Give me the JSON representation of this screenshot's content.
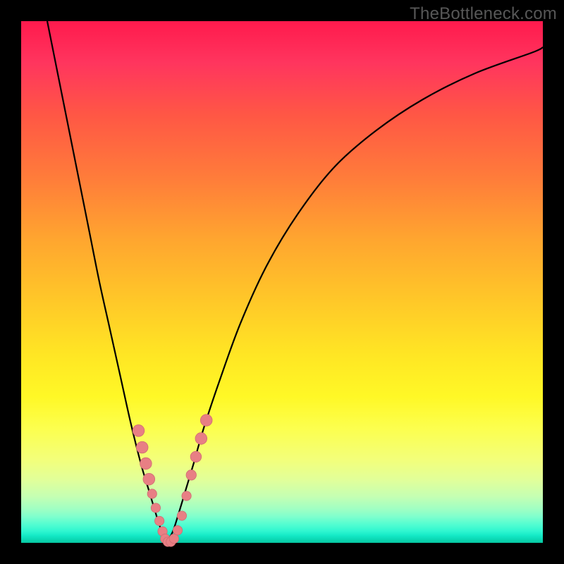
{
  "watermark": "TheBottleneck.com",
  "colors": {
    "curve": "#000000",
    "marker_fill": "#e87f84",
    "marker_stroke": "#cf6d72",
    "background_frame": "#000000"
  },
  "chart_data": {
    "type": "line",
    "title": "",
    "xlabel": "",
    "ylabel": "",
    "xlim": [
      0,
      100
    ],
    "ylim": [
      0,
      100
    ],
    "grid": false,
    "legend": false,
    "series": [
      {
        "name": "bottleneck-curve-left",
        "x": [
          5,
          7,
          9,
          11,
          13,
          15,
          17,
          19,
          21,
          23,
          24.5,
          26,
          27,
          27.8
        ],
        "values": [
          100,
          90,
          80,
          70,
          60,
          50,
          41,
          32,
          23,
          15,
          10,
          5,
          2,
          0
        ]
      },
      {
        "name": "bottleneck-curve-right",
        "x": [
          27.8,
          29,
          30,
          31.5,
          33,
          35,
          38,
          42,
          47,
          53,
          60,
          68,
          77,
          87,
          98,
          100
        ],
        "values": [
          0,
          2,
          5,
          10,
          15,
          22,
          31,
          42,
          53,
          63,
          72,
          79,
          85,
          90,
          94,
          95
        ]
      }
    ],
    "markers": [
      {
        "x": 22.5,
        "y": 21.5,
        "r": 1.5
      },
      {
        "x": 23.2,
        "y": 18.3,
        "r": 1.5
      },
      {
        "x": 23.9,
        "y": 15.2,
        "r": 1.5
      },
      {
        "x": 24.5,
        "y": 12.2,
        "r": 1.5
      },
      {
        "x": 25.1,
        "y": 9.4,
        "r": 1.2
      },
      {
        "x": 25.8,
        "y": 6.7,
        "r": 1.2
      },
      {
        "x": 26.5,
        "y": 4.2,
        "r": 1.2
      },
      {
        "x": 27.1,
        "y": 2.2,
        "r": 1.2
      },
      {
        "x": 27.6,
        "y": 0.8,
        "r": 1.2
      },
      {
        "x": 28.1,
        "y": 0.2,
        "r": 1.2
      },
      {
        "x": 28.7,
        "y": 0.2,
        "r": 1.2
      },
      {
        "x": 29.3,
        "y": 0.8,
        "r": 1.2
      },
      {
        "x": 30.0,
        "y": 2.4,
        "r": 1.2
      },
      {
        "x": 30.8,
        "y": 5.2,
        "r": 1.2
      },
      {
        "x": 31.7,
        "y": 9.0,
        "r": 1.2
      },
      {
        "x": 32.6,
        "y": 13.0,
        "r": 1.3
      },
      {
        "x": 33.5,
        "y": 16.5,
        "r": 1.4
      },
      {
        "x": 34.5,
        "y": 20.0,
        "r": 1.5
      },
      {
        "x": 35.5,
        "y": 23.5,
        "r": 1.5
      }
    ],
    "gradient_stops": [
      {
        "pct": 0,
        "color": "#ff1a4d"
      },
      {
        "pct": 30,
        "color": "#ff7c3a"
      },
      {
        "pct": 64,
        "color": "#ffe624"
      },
      {
        "pct": 78,
        "color": "#fcff4e"
      },
      {
        "pct": 95,
        "color": "#7effcd"
      },
      {
        "pct": 100,
        "color": "#07c7a1"
      }
    ]
  }
}
